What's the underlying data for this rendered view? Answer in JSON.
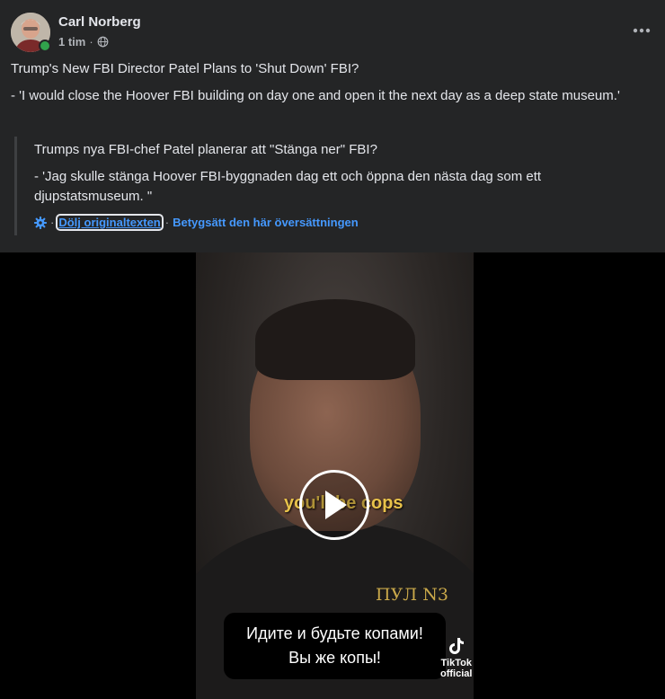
{
  "post": {
    "author": "Carl Norberg",
    "time": "1 tim",
    "separator": "·",
    "title": "Trump's New FBI Director Patel Plans to 'Shut Down' FBI?",
    "body": "- 'I would close the Hoover FBI building on day one and open it the next day as a deep state museum.'"
  },
  "translation": {
    "title": "Trumps nya FBI-chef Patel planerar att \"Stänga ner\" FBI?",
    "body": "- 'Jag skulle stänga Hoover FBI-byggnaden dag ett och öppna den nästa dag som ett djupstatsmuseum. \"",
    "hide_original": "Dölj originaltexten",
    "rate_translation": "Betygsätt den här översättningen",
    "dot": "·"
  },
  "video": {
    "subtitle": "you'll be cops",
    "caption_pul": "ПУЛ N3",
    "ru_line1": "Идите и будьте копами!",
    "ru_line2": "Вы же копы!",
    "tiktok_label": "TikTok",
    "tiktok_handle": "official"
  },
  "icons": {
    "globe": "globe-icon",
    "more": "more-horizontal-icon",
    "translate": "gear-icon",
    "play": "play-icon"
  },
  "colors": {
    "background": "#242526",
    "text": "#e4e6eb",
    "secondary": "#b0b3b8",
    "link": "#4599ff",
    "online": "#31a24c"
  }
}
